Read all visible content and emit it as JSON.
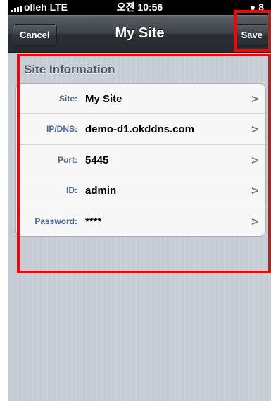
{
  "status_bar": {
    "carrier": "olleh",
    "network": "LTE",
    "time": "오전 10:56",
    "battery": "8"
  },
  "nav_bar": {
    "title": "My Site",
    "cancel_label": "Cancel",
    "save_label": "Save"
  },
  "section": {
    "title": "Site Information"
  },
  "fields": [
    {
      "label": "Site:",
      "value": "My Site"
    },
    {
      "label": "IP/DNS:",
      "value": "demo-d1.okddns.com"
    },
    {
      "label": "Port:",
      "value": "5445"
    },
    {
      "label": "ID:",
      "value": "admin"
    },
    {
      "label": "Password:",
      "value": "****"
    }
  ],
  "colors": {
    "highlight": "#ff0000",
    "label_blue": "#4c6a9a",
    "section_header": "#4c566c"
  }
}
